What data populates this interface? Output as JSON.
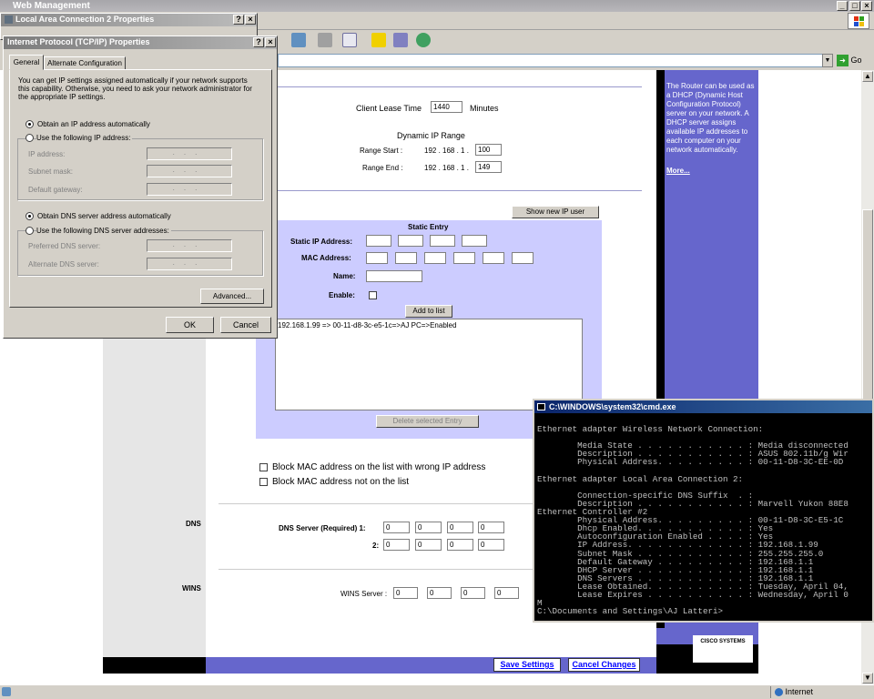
{
  "ie": {
    "title": "Web Management",
    "address_go": "Go",
    "status_text": "Internet"
  },
  "dhcp": {
    "lease_label": "Client Lease Time",
    "lease_value": "1440",
    "lease_unit": "Minutes",
    "range_heading": "Dynamic IP Range",
    "range_start_label": "Range Start :",
    "range_start_prefix": "192 . 168 . 1 .",
    "range_start_value": "100",
    "range_end_label": "Range End :",
    "range_end_prefix": "192 . 168 . 1 .",
    "range_end_value": "149"
  },
  "static": {
    "show_button": "Show new IP user",
    "heading": "Static Entry",
    "ip_label": "Static IP Address:",
    "mac_label": "MAC Address:",
    "name_label": "Name:",
    "enable_label": "Enable:",
    "add_button": "Add to list",
    "list_entry": "192.168.1.99 => 00-11-d8-3c-e5-1c=>AJ PC=>Enabled",
    "delete_button": "Delete selected Entry",
    "block_wrong_ip": "Block MAC address on the list with wrong IP address",
    "block_not_on_list": "Block MAC address not on the list"
  },
  "dns": {
    "section_label": "DNS",
    "server1_label": "DNS Server (Required) 1:",
    "server2_label": "2:",
    "server1": [
      "0",
      "0",
      "0",
      "0"
    ],
    "server2": [
      "0",
      "0",
      "0",
      "0"
    ]
  },
  "wins": {
    "section_label": "WINS",
    "server_label": "WINS Server :",
    "server": [
      "0",
      "0",
      "0",
      "0"
    ]
  },
  "sidebar": {
    "help_text": "The Router can be used as a DHCP (Dynamic Host Configuration Protocol) server on your network. A DHCP server assigns available IP addresses to each computer on your network automatically.",
    "more_link": "More..."
  },
  "footer": {
    "save": "Save Settings",
    "cancel": "Cancel Changes",
    "brand": "CISCO SYSTEMS"
  },
  "lan_dialog": {
    "title": "Local Area Connection 2 Properties"
  },
  "tcpip": {
    "title": "Internet Protocol (TCP/IP) Properties",
    "tab_general": "General",
    "tab_alternate": "Alternate Configuration",
    "description": "You can get IP settings assigned automatically if your network supports this capability. Otherwise, you need to ask your network administrator for the appropriate IP settings.",
    "obtain_ip_auto": "Obtain an IP address automatically",
    "use_following_ip": "Use the following IP address:",
    "ip_address": "IP address:",
    "subnet_mask": "Subnet mask:",
    "default_gateway": "Default gateway:",
    "obtain_dns_auto": "Obtain DNS server address automatically",
    "use_following_dns": "Use the following DNS server addresses:",
    "preferred_dns": "Preferred DNS server:",
    "alternate_dns": "Alternate DNS server:",
    "advanced_button": "Advanced...",
    "ok_button": "OK",
    "cancel_button": "Cancel"
  },
  "cmd": {
    "title": "C:\\WINDOWS\\system32\\cmd.exe",
    "lines": [
      "",
      "Ethernet adapter Wireless Network Connection:",
      "",
      "        Media State . . . . . . . . . . . : Media disconnected",
      "        Description . . . . . . . . . . . : ASUS 802.11b/g Wir",
      "        Physical Address. . . . . . . . . : 00-11-D8-3C-EE-0D",
      "",
      "Ethernet adapter Local Area Connection 2:",
      "",
      "        Connection-specific DNS Suffix  . :",
      "        Description . . . . . . . . . . . : Marvell Yukon 88E8",
      "Ethernet Controller #2",
      "        Physical Address. . . . . . . . . : 00-11-D8-3C-E5-1C",
      "        Dhcp Enabled. . . . . . . . . . . : Yes",
      "        Autoconfiguration Enabled . . . . : Yes",
      "        IP Address. . . . . . . . . . . . : 192.168.1.99",
      "        Subnet Mask . . . . . . . . . . . : 255.255.255.0",
      "        Default Gateway . . . . . . . . . : 192.168.1.1",
      "        DHCP Server . . . . . . . . . . . : 192.168.1.1",
      "        DNS Servers . . . . . . . . . . . : 192.168.1.1",
      "        Lease Obtained. . . . . . . . . . : Tuesday, April 04,",
      "        Lease Expires . . . . . . . . . . : Wednesday, April 0",
      "M",
      "C:\\Documents and Settings\\AJ Latteri>"
    ]
  }
}
